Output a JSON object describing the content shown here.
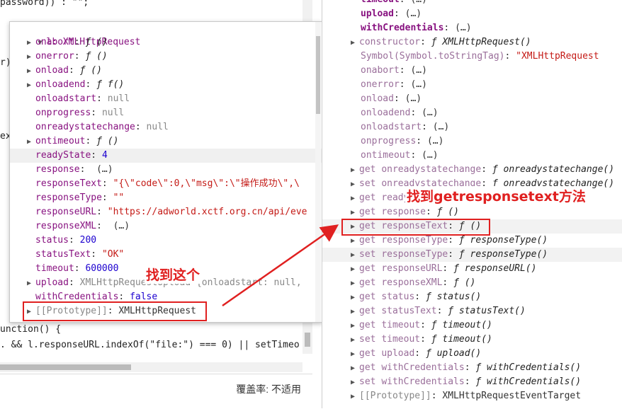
{
  "source": {
    "lines": [
      {
        "text": "password)) : \"\";"
      },
      {
        "text": "r)"
      },
      {
        "text": "ext"
      },
      {
        "text": "unction() {"
      },
      {
        "text": ". && l.responseURL.indexOf(\"file:\") === 0) || setTimeo"
      }
    ],
    "coverage": "覆盖率: 不适用"
  },
  "popover": {
    "title": "l: XMLHttpRequest",
    "rows": [
      {
        "tri": "▶",
        "key": "onabort",
        "sep": ": ",
        "val": "ƒ ()",
        "vtype": "f"
      },
      {
        "tri": "▶",
        "key": "onerror",
        "sep": ": ",
        "val": "ƒ ()",
        "vtype": "f"
      },
      {
        "tri": "▶",
        "key": "onload",
        "sep": ": ",
        "val": "ƒ ()",
        "vtype": "f"
      },
      {
        "tri": "▶",
        "key": "onloadend",
        "sep": ": ",
        "val": "ƒ f()",
        "vtype": "f"
      },
      {
        "tri": "",
        "key": "onloadstart",
        "sep": ": ",
        "val": "null",
        "vtype": "g"
      },
      {
        "tri": "",
        "key": "onprogress",
        "sep": ": ",
        "val": "null",
        "vtype": "g"
      },
      {
        "tri": "",
        "key": "onreadystatechange",
        "sep": ": ",
        "val": "null",
        "vtype": "g"
      },
      {
        "tri": "▶",
        "key": "ontimeout",
        "sep": ": ",
        "val": "ƒ ()",
        "vtype": "f"
      },
      {
        "tri": "",
        "key": "readyState",
        "sep": ": ",
        "val": "4",
        "vtype": "n"
      },
      {
        "tri": "",
        "key": "response",
        "sep": ": ",
        "val": " (…)",
        "vtype": "u"
      },
      {
        "tri": "",
        "key": "responseText",
        "sep": ": ",
        "val": "\"{\\\"code\\\":0,\\\"msg\\\":\\\"操作成功\\\",\\",
        "vtype": "s"
      },
      {
        "tri": "",
        "key": "responseType",
        "sep": ": ",
        "val": "\"\"",
        "vtype": "s"
      },
      {
        "tri": "",
        "key": "responseURL",
        "sep": ": ",
        "val": "\"https://adworld.xctf.org.cn/api/eve",
        "vtype": "s"
      },
      {
        "tri": "",
        "key": "responseXML",
        "sep": ": ",
        "val": " (…)",
        "vtype": "u"
      },
      {
        "tri": "",
        "key": "status",
        "sep": ": ",
        "val": "200",
        "vtype": "n"
      },
      {
        "tri": "",
        "key": "statusText",
        "sep": ": ",
        "val": "\"OK\"",
        "vtype": "s"
      },
      {
        "tri": "",
        "key": "timeout",
        "sep": ": ",
        "val": "600000",
        "vtype": "n"
      },
      {
        "tri": "▶",
        "key": "upload",
        "sep": ": ",
        "val": "XMLHttpRequestUpload {onloadstart: null,",
        "vtype": "g"
      },
      {
        "tri": "",
        "key": "withCredentials",
        "sep": ": ",
        "val": "false",
        "vtype": "n"
      },
      {
        "tri": "▶",
        "key": "[[Prototype]]",
        "sep": ": ",
        "val": "XMLHttpRequest",
        "vtype": "u"
      }
    ]
  },
  "scope": {
    "rows": [
      {
        "tri": "",
        "pre": "",
        "key": "timeout",
        "sep": ": ",
        "val": "(…)",
        "vtype": "u",
        "kclass": "k"
      },
      {
        "tri": "",
        "pre": "",
        "key": "upload",
        "sep": ": ",
        "val": "(…)",
        "vtype": "u",
        "kclass": "k"
      },
      {
        "tri": "",
        "pre": "",
        "key": "withCredentials",
        "sep": ": ",
        "val": "(…)",
        "vtype": "u",
        "kclass": "k"
      },
      {
        "tri": "▶",
        "pre": "",
        "key": "constructor",
        "sep": ": ",
        "val": "ƒ XMLHttpRequest()",
        "vtype": "f",
        "kclass": "kd"
      },
      {
        "tri": "",
        "pre": "",
        "key": "Symbol(Symbol.toStringTag)",
        "sep": ": ",
        "val": "\"XMLHttpRequest",
        "vtype": "s",
        "kclass": "kd"
      },
      {
        "tri": "",
        "pre": "",
        "key": "onabort",
        "sep": ": ",
        "val": "(…)",
        "vtype": "u",
        "kclass": "kd"
      },
      {
        "tri": "",
        "pre": "",
        "key": "onerror",
        "sep": ": ",
        "val": "(…)",
        "vtype": "u",
        "kclass": "kd"
      },
      {
        "tri": "",
        "pre": "",
        "key": "onload",
        "sep": ": ",
        "val": "(…)",
        "vtype": "u",
        "kclass": "kd"
      },
      {
        "tri": "",
        "pre": "",
        "key": "onloadend",
        "sep": ": ",
        "val": "(…)",
        "vtype": "u",
        "kclass": "kd"
      },
      {
        "tri": "",
        "pre": "",
        "key": "onloadstart",
        "sep": ": ",
        "val": "(…)",
        "vtype": "u",
        "kclass": "kd"
      },
      {
        "tri": "",
        "pre": "",
        "key": "onprogress",
        "sep": ": ",
        "val": "(…)",
        "vtype": "u",
        "kclass": "kd"
      },
      {
        "tri": "",
        "pre": "",
        "key": "ontimeout",
        "sep": ": ",
        "val": "(…)",
        "vtype": "u",
        "kclass": "kd"
      },
      {
        "tri": "▶",
        "pre": "get ",
        "key": "onreadystatechange",
        "sep": ": ",
        "val": "ƒ onreadystatechange()",
        "vtype": "f",
        "kclass": "kd"
      },
      {
        "tri": "▶",
        "pre": "set ",
        "key": "onreadystatechange",
        "sep": ": ",
        "val": "ƒ onreadystatechange()",
        "vtype": "f",
        "kclass": "kd"
      },
      {
        "tri": "▶",
        "pre": "get ",
        "key": "readyState",
        "sep": ": ",
        "val": "ƒ readyState()",
        "vtype": "f",
        "kclass": "kd"
      },
      {
        "tri": "▶",
        "pre": "get ",
        "key": "response",
        "sep": ": ",
        "val": "ƒ ()",
        "vtype": "f",
        "kclass": "kd"
      },
      {
        "tri": "▶",
        "pre": "get ",
        "key": "responseText",
        "sep": ": ",
        "val": "ƒ ()",
        "vtype": "f",
        "kclass": "kd"
      },
      {
        "tri": "▶",
        "pre": "get ",
        "key": "responseType",
        "sep": ": ",
        "val": "ƒ responseType()",
        "vtype": "f",
        "kclass": "kd"
      },
      {
        "tri": "▶",
        "pre": "set ",
        "key": "responseType",
        "sep": ": ",
        "val": "ƒ responseType()",
        "vtype": "f",
        "kclass": "kd"
      },
      {
        "tri": "▶",
        "pre": "get ",
        "key": "responseURL",
        "sep": ": ",
        "val": "ƒ responseURL()",
        "vtype": "f",
        "kclass": "kd"
      },
      {
        "tri": "▶",
        "pre": "get ",
        "key": "responseXML",
        "sep": ": ",
        "val": "ƒ ()",
        "vtype": "f",
        "kclass": "kd"
      },
      {
        "tri": "▶",
        "pre": "get ",
        "key": "status",
        "sep": ": ",
        "val": "ƒ status()",
        "vtype": "f",
        "kclass": "kd"
      },
      {
        "tri": "▶",
        "pre": "get ",
        "key": "statusText",
        "sep": ": ",
        "val": "ƒ statusText()",
        "vtype": "f",
        "kclass": "kd"
      },
      {
        "tri": "▶",
        "pre": "get ",
        "key": "timeout",
        "sep": ": ",
        "val": "ƒ timeout()",
        "vtype": "f",
        "kclass": "kd"
      },
      {
        "tri": "▶",
        "pre": "set ",
        "key": "timeout",
        "sep": ": ",
        "val": "ƒ timeout()",
        "vtype": "f",
        "kclass": "kd"
      },
      {
        "tri": "▶",
        "pre": "get ",
        "key": "upload",
        "sep": ": ",
        "val": "ƒ upload()",
        "vtype": "f",
        "kclass": "kd"
      },
      {
        "tri": "▶",
        "pre": "get ",
        "key": "withCredentials",
        "sep": ": ",
        "val": "ƒ withCredentials()",
        "vtype": "f",
        "kclass": "kd"
      },
      {
        "tri": "▶",
        "pre": "set ",
        "key": "withCredentials",
        "sep": ": ",
        "val": "ƒ withCredentials()",
        "vtype": "f",
        "kclass": "kd"
      },
      {
        "tri": "▶",
        "pre": "",
        "key": "[[Prototype]]",
        "sep": ": ",
        "val": "XMLHttpRequestEventTarget",
        "vtype": "u",
        "kclass": "g"
      }
    ]
  },
  "annotations": {
    "left_label": "找到这个",
    "right_label": "找到getresponsetext方法",
    "color": "#e02020"
  }
}
